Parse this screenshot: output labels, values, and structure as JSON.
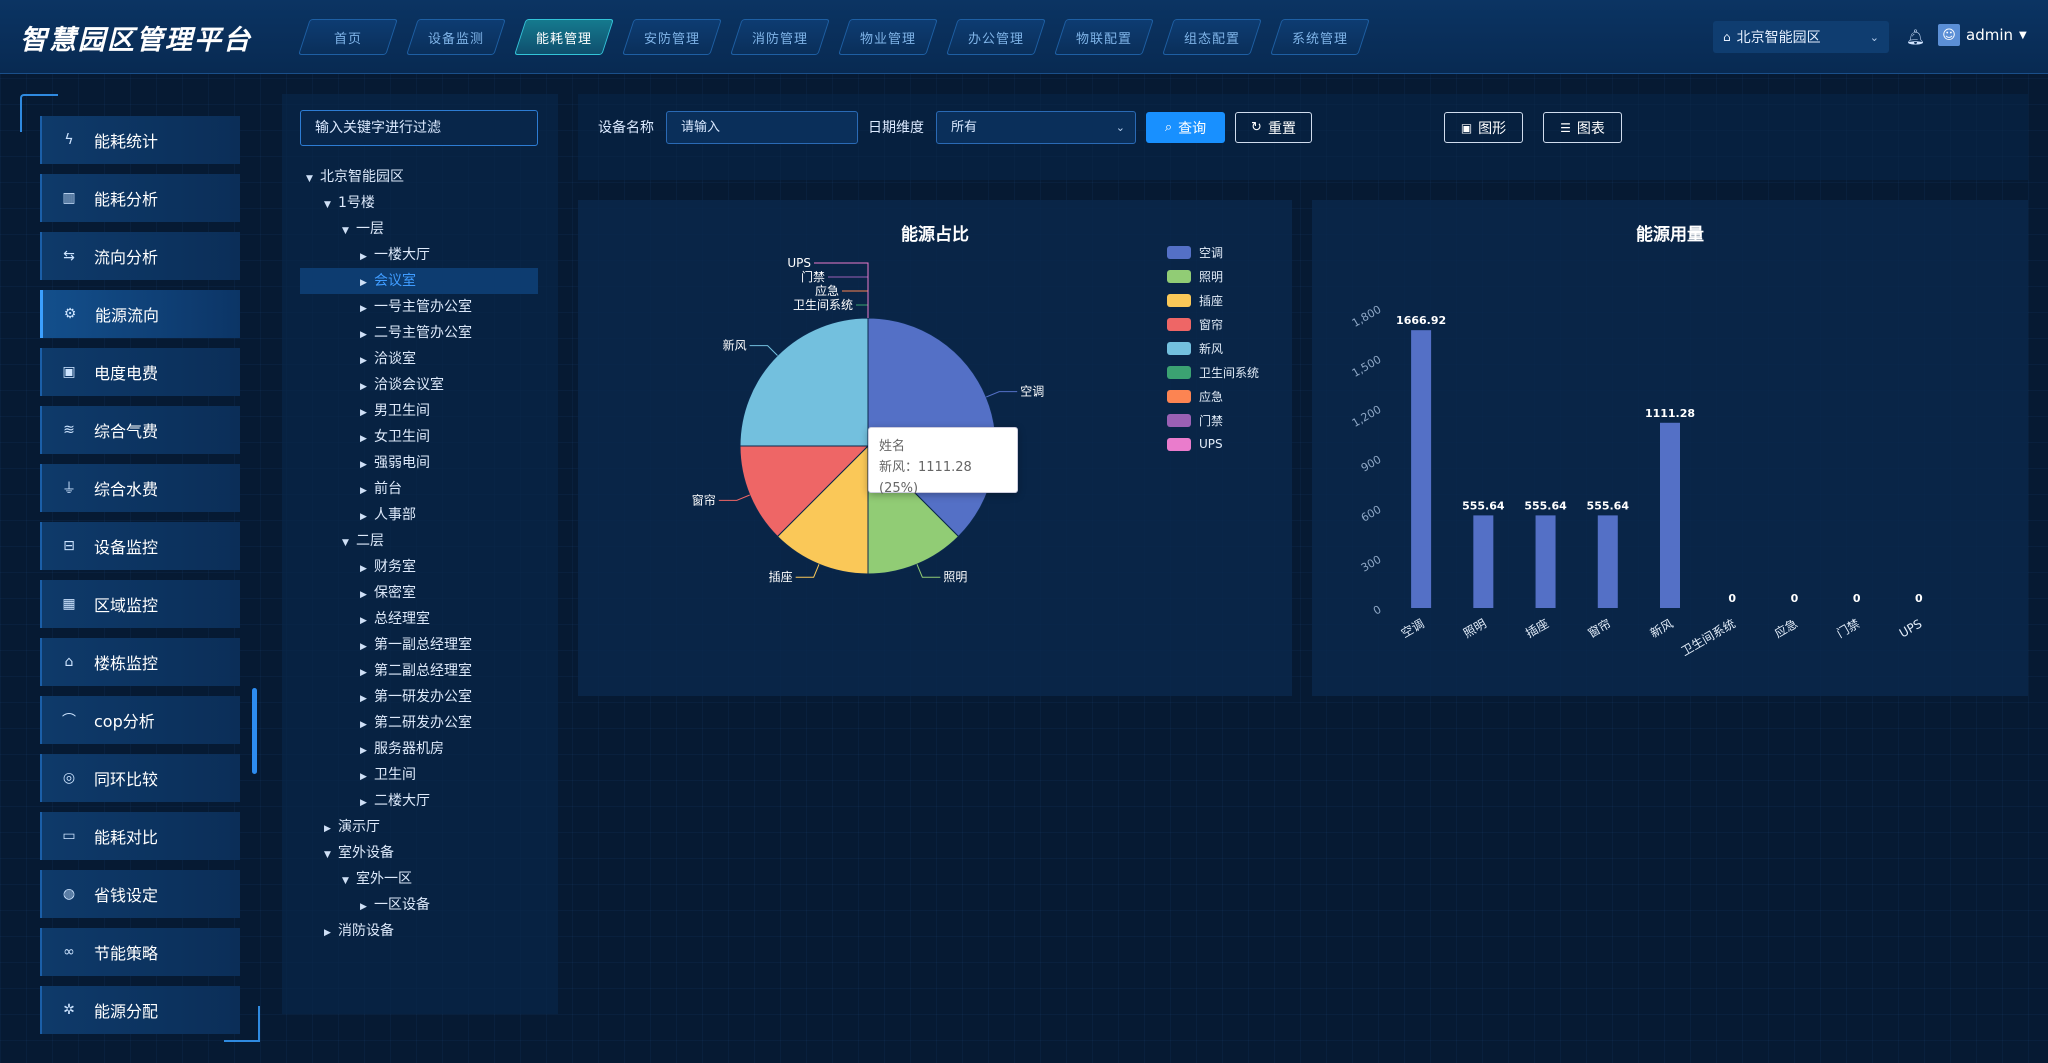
{
  "header": {
    "title": "智慧园区管理平台",
    "nav": [
      {
        "label": "首页",
        "active": false
      },
      {
        "label": "设备监测",
        "active": false
      },
      {
        "label": "能耗管理",
        "active": true
      },
      {
        "label": "安防管理",
        "active": false
      },
      {
        "label": "消防管理",
        "active": false
      },
      {
        "label": "物业管理",
        "active": false
      },
      {
        "label": "办公管理",
        "active": false
      },
      {
        "label": "物联配置",
        "active": false
      },
      {
        "label": "组态配置",
        "active": false
      },
      {
        "label": "系统管理",
        "active": false
      }
    ],
    "park": "北京智能园区",
    "user": "admin"
  },
  "sidebar": {
    "items": [
      {
        "label": "能耗统计",
        "icon": "bolt-icon",
        "glyph": "ϟ",
        "active": false
      },
      {
        "label": "能耗分析",
        "icon": "bar-chart-icon",
        "glyph": "▥",
        "active": false
      },
      {
        "label": "流向分析",
        "icon": "flow-icon",
        "glyph": "⇆",
        "active": false
      },
      {
        "label": "能源流向",
        "icon": "gear-icon",
        "glyph": "⚙",
        "active": true
      },
      {
        "label": "电度电费",
        "icon": "bill-icon",
        "glyph": "▣",
        "active": false
      },
      {
        "label": "综合气费",
        "icon": "gas-icon",
        "glyph": "≋",
        "active": false
      },
      {
        "label": "综合水费",
        "icon": "water-icon",
        "glyph": "⏚",
        "active": false
      },
      {
        "label": "设备监控",
        "icon": "device-icon",
        "glyph": "⊟",
        "active": false
      },
      {
        "label": "区域监控",
        "icon": "region-icon",
        "glyph": "▦",
        "active": false
      },
      {
        "label": "楼栋监控",
        "icon": "building-icon",
        "glyph": "⌂",
        "active": false
      },
      {
        "label": "cop分析",
        "icon": "curve-icon",
        "glyph": "⌒",
        "active": false
      },
      {
        "label": "同环比较",
        "icon": "compare-icon",
        "glyph": "◎",
        "active": false
      },
      {
        "label": "能耗对比",
        "icon": "contrast-icon",
        "glyph": "▭",
        "active": false
      },
      {
        "label": "省钱设定",
        "icon": "saving-icon",
        "glyph": "◍",
        "active": false
      },
      {
        "label": "节能策略",
        "icon": "link-icon",
        "glyph": "∞",
        "active": false
      },
      {
        "label": "能源分配",
        "icon": "distribute-icon",
        "glyph": "✲",
        "active": false
      }
    ]
  },
  "tree": {
    "filter_placeholder": "输入关键字进行过滤",
    "nodes": [
      {
        "label": "北京智能园区",
        "level": 0,
        "arrow": "down",
        "selected": false
      },
      {
        "label": "1号楼",
        "level": 1,
        "arrow": "down",
        "selected": false
      },
      {
        "label": "一层",
        "level": 2,
        "arrow": "down",
        "selected": false
      },
      {
        "label": "一楼大厅",
        "level": 3,
        "arrow": "right",
        "selected": false
      },
      {
        "label": "会议室",
        "level": 3,
        "arrow": "right",
        "selected": true
      },
      {
        "label": "一号主管办公室",
        "level": 3,
        "arrow": "right",
        "selected": false
      },
      {
        "label": "二号主管办公室",
        "level": 3,
        "arrow": "right",
        "selected": false
      },
      {
        "label": "洽谈室",
        "level": 3,
        "arrow": "right",
        "selected": false
      },
      {
        "label": "洽谈会议室",
        "level": 3,
        "arrow": "right",
        "selected": false
      },
      {
        "label": "男卫生间",
        "level": 3,
        "arrow": "right",
        "selected": false
      },
      {
        "label": "女卫生间",
        "level": 3,
        "arrow": "right",
        "selected": false
      },
      {
        "label": "强弱电间",
        "level": 3,
        "arrow": "right",
        "selected": false
      },
      {
        "label": "前台",
        "level": 3,
        "arrow": "right",
        "selected": false
      },
      {
        "label": "人事部",
        "level": 3,
        "arrow": "right",
        "selected": false
      },
      {
        "label": "二层",
        "level": 2,
        "arrow": "down",
        "selected": false
      },
      {
        "label": "财务室",
        "level": 3,
        "arrow": "right",
        "selected": false
      },
      {
        "label": "保密室",
        "level": 3,
        "arrow": "right",
        "selected": false
      },
      {
        "label": "总经理室",
        "level": 3,
        "arrow": "right",
        "selected": false
      },
      {
        "label": "第一副总经理室",
        "level": 3,
        "arrow": "right",
        "selected": false
      },
      {
        "label": "第二副总经理室",
        "level": 3,
        "arrow": "right",
        "selected": false
      },
      {
        "label": "第一研发办公室",
        "level": 3,
        "arrow": "right",
        "selected": false
      },
      {
        "label": "第二研发办公室",
        "level": 3,
        "arrow": "right",
        "selected": false
      },
      {
        "label": "服务器机房",
        "level": 3,
        "arrow": "right",
        "selected": false
      },
      {
        "label": "卫生间",
        "level": 3,
        "arrow": "right",
        "selected": false
      },
      {
        "label": "二楼大厅",
        "level": 3,
        "arrow": "right",
        "selected": false
      },
      {
        "label": "演示厅",
        "level": 1,
        "arrow": "right",
        "selected": false
      },
      {
        "label": "室外设备",
        "level": 1,
        "arrow": "down",
        "selected": false
      },
      {
        "label": "室外一区",
        "level": 2,
        "arrow": "down",
        "selected": false
      },
      {
        "label": "一区设备",
        "level": 3,
        "arrow": "right",
        "selected": false
      },
      {
        "label": "消防设备",
        "level": 1,
        "arrow": "right",
        "selected": false
      }
    ]
  },
  "query": {
    "device_label": "设备名称",
    "device_placeholder": "请输入",
    "date_label": "日期维度",
    "date_value": "所有",
    "search_label": "查询",
    "reset_label": "重置",
    "graph_label": "图形",
    "table_label": "图表"
  },
  "pie_panel": {
    "title": "能源占比",
    "tooltip_title": "姓名",
    "tooltip_value": "新风：1111.28 (25%)"
  },
  "bar_panel": {
    "title": "能源用量"
  },
  "chart_data": [
    {
      "type": "pie",
      "title": "能源占比",
      "categories": [
        "空调",
        "照明",
        "插座",
        "窗帘",
        "新风",
        "卫生间系统",
        "应急",
        "门禁",
        "UPS"
      ],
      "values": [
        1666.92,
        555.64,
        555.64,
        555.64,
        1111.28,
        0,
        0,
        0,
        0
      ],
      "colors": [
        "#5470c6",
        "#91cc75",
        "#fac858",
        "#ee6666",
        "#73c0de",
        "#3ba272",
        "#fc8452",
        "#9a60b4",
        "#ea7ccc"
      ],
      "legend_position": "top-right"
    },
    {
      "type": "bar",
      "title": "能源用量",
      "categories": [
        "空调",
        "照明",
        "插座",
        "窗帘",
        "新风",
        "卫生间系统",
        "应急",
        "门禁",
        "UPS"
      ],
      "values": [
        1666.92,
        555.64,
        555.64,
        555.64,
        1111.28,
        0,
        0,
        0,
        0
      ],
      "value_labels": [
        "1666.92",
        "555.64",
        "555.64",
        "555.64",
        "1111.28",
        "0",
        "0",
        "0",
        "0"
      ],
      "y_ticks": [
        "0",
        "300",
        "600",
        "900",
        "1,200",
        "1,500",
        "1,800"
      ],
      "ylim": [
        0,
        1800
      ],
      "color": "#5470c6",
      "grid": false
    }
  ]
}
